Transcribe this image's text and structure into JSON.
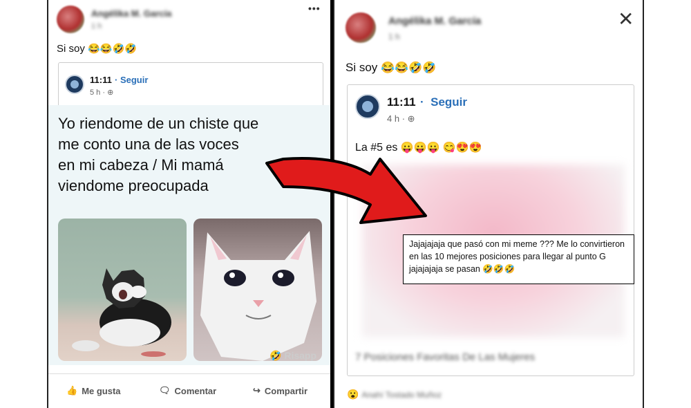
{
  "left_post": {
    "author": "Angélika M. García",
    "time": "1 h",
    "more": "•••",
    "text": "Si soy",
    "text_emoji": "😂😂🤣🤣",
    "embed": {
      "page": "11:11",
      "follow": "Seguir",
      "time": "5 h"
    },
    "meme_lines": [
      "Yo riendome de un chiste que",
      "me conto una de las voces",
      "en mi cabeza / Mi mamá",
      "viendome preocupada"
    ],
    "watermark": "Risapp",
    "actions": {
      "like": "Me gusta",
      "comment": "Comentar",
      "share": "Compartir"
    }
  },
  "right_post": {
    "author": "Angélika M. García",
    "time": "1 h",
    "close": "✕",
    "text": "Si soy",
    "text_emoji": "😂😂🤣🤣",
    "embed": {
      "page": "11:11",
      "separator": "·",
      "follow": "Seguir",
      "time": "4 h",
      "text": "La #5 es",
      "text_emoji": "😛😛😛 😋😍😍"
    },
    "blurred_caption": "7 Posiciones Favoritas De Las Mujeres",
    "callout": "Jajajajaja que pasó con mi meme ??? Me lo convirtieron en las 10 mejores posiciones para llegar al punto G jajajajaja se pasan 🤣🤣🤣",
    "reaction_emoji": "😮",
    "reaction_name": "Anahí Tostado Muñoz"
  },
  "colors": {
    "arrow": "#e01b1b",
    "link": "#2a6fb8",
    "meme_bg": "#eef6f8"
  }
}
